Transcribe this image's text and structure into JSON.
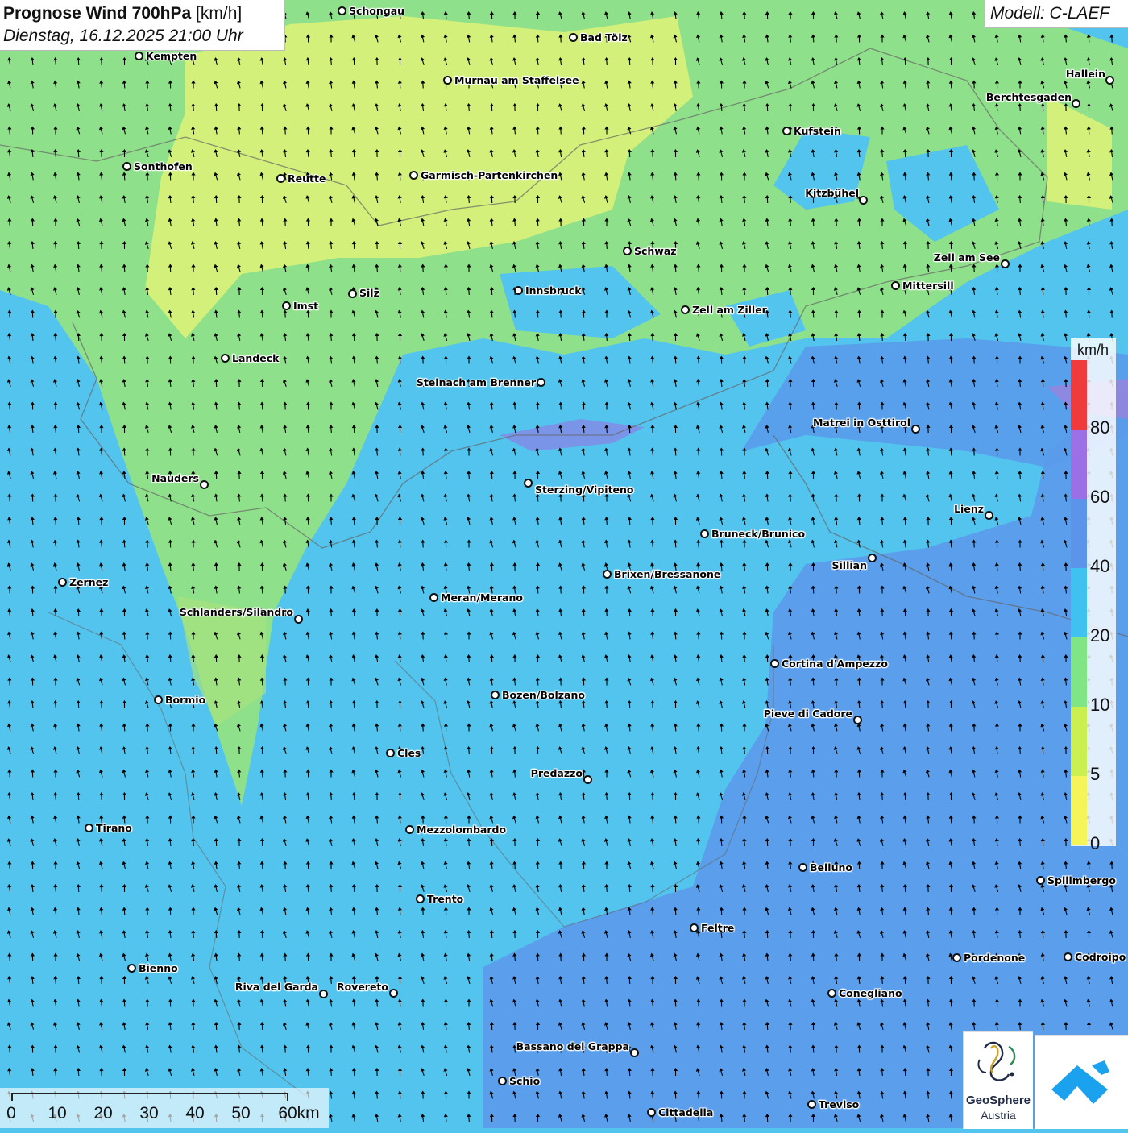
{
  "header": {
    "title_bold": "Prognose Wind 700hPa",
    "title_unit": "[km/h]",
    "datetime": "Dienstag, 16.12.2025 21:00 Uhr"
  },
  "model": {
    "label": "Modell: C-LAEF"
  },
  "map": {
    "wind_arrow_direction": "north to north-northwest",
    "field_colors": {
      "lowest_yellow_green": "#d6f07a",
      "green": "#8fe088",
      "cyan": "#52c4ee",
      "blue": "#5a9bec",
      "purple": "#9a70e2",
      "red": "#f03c3c"
    },
    "cities": [
      {
        "name": "Schongau"
      },
      {
        "name": "Bad Tölz"
      },
      {
        "name": "Kempten"
      },
      {
        "name": "Murnau am Staffelsee"
      },
      {
        "name": "Hallein"
      },
      {
        "name": "Berchtesgaden"
      },
      {
        "name": "Kufstein"
      },
      {
        "name": "Sonthofen"
      },
      {
        "name": "Reutte"
      },
      {
        "name": "Garmisch-Partenkirchen"
      },
      {
        "name": "Kitzbühel"
      },
      {
        "name": "Schwaz"
      },
      {
        "name": "Zell am See"
      },
      {
        "name": "Mittersill"
      },
      {
        "name": "Imst"
      },
      {
        "name": "Silz"
      },
      {
        "name": "Innsbruck"
      },
      {
        "name": "Zell am Ziller"
      },
      {
        "name": "Landeck"
      },
      {
        "name": "Steinach am Brenner"
      },
      {
        "name": "Matrei in Osttirol"
      },
      {
        "name": "Nauders"
      },
      {
        "name": "Sterzing/Vipiteno"
      },
      {
        "name": "Lienz"
      },
      {
        "name": "Bruneck/Brunico"
      },
      {
        "name": "Sillian"
      },
      {
        "name": "Zernez"
      },
      {
        "name": "Brixen/Bressanone"
      },
      {
        "name": "Meran/Merano"
      },
      {
        "name": "Schlanders/Silandro"
      },
      {
        "name": "Cortina d'Ampezzo"
      },
      {
        "name": "Bozen/Bolzano"
      },
      {
        "name": "Bormio"
      },
      {
        "name": "Pieve di Cadore"
      },
      {
        "name": "Cles"
      },
      {
        "name": "Predazzo"
      },
      {
        "name": "Tirano"
      },
      {
        "name": "Mezzolombardo"
      },
      {
        "name": "Belluno"
      },
      {
        "name": "Spilimbergo"
      },
      {
        "name": "Trento"
      },
      {
        "name": "Feltre"
      },
      {
        "name": "Pordenone"
      },
      {
        "name": "Codroipo"
      },
      {
        "name": "Bienno"
      },
      {
        "name": "Riva del Garda"
      },
      {
        "name": "Rovereto"
      },
      {
        "name": "Conegliano"
      },
      {
        "name": "Bassano del Grappa"
      },
      {
        "name": "Schio"
      },
      {
        "name": "Treviso"
      },
      {
        "name": "Cittadella"
      }
    ]
  },
  "legend": {
    "unit": "km/h",
    "ticks": [
      "80",
      "60",
      "40",
      "20",
      "10",
      "5",
      "0"
    ],
    "colors": [
      "#ef3b3b",
      "#9b6fe6",
      "#5b94ea",
      "#3fc2ef",
      "#7fe585",
      "#c9f050",
      "#f5f55a"
    ]
  },
  "scale": {
    "labels": [
      "0",
      "10",
      "20",
      "30",
      "40",
      "50",
      "60km"
    ]
  },
  "logos": {
    "geosphere_name": "GeoSphere",
    "geosphere_sub": "Austria"
  }
}
